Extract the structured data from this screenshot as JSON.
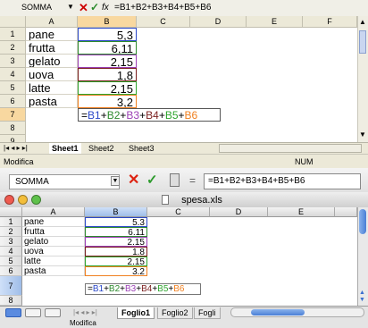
{
  "colors": {
    "b1": "#2b48c8",
    "b2": "#2e8b2e",
    "b3": "#9b3fb5",
    "b4": "#7a1f1f",
    "b5": "#2ea52e",
    "b6": "#f08020"
  },
  "win": {
    "name_box": "SOMMA",
    "formula": "=B1+B2+B3+B4+B5+B6",
    "fx_label": "fx",
    "columns": [
      "A",
      "B",
      "C",
      "D",
      "E",
      "F"
    ],
    "rows": [
      "1",
      "2",
      "3",
      "4",
      "5",
      "6",
      "7",
      "8",
      "9"
    ],
    "items": [
      {
        "name": "pane",
        "value": "5,3"
      },
      {
        "name": "frutta",
        "value": "6,11"
      },
      {
        "name": "gelato",
        "value": "2,15"
      },
      {
        "name": "uova",
        "value": "1,8"
      },
      {
        "name": "latte",
        "value": "2,15"
      },
      {
        "name": "pasta",
        "value": "3,2"
      }
    ],
    "formula_parts": [
      "=",
      "B1",
      "+",
      "B2",
      "+",
      "B3",
      "+",
      "B4",
      "+",
      "B5",
      "+",
      "B6"
    ],
    "sheet_tabs": [
      "Sheet1",
      "Sheet2",
      "Sheet3"
    ],
    "status_left": "Modifica",
    "status_right": "NUM"
  },
  "mac": {
    "name_box": "SOMMA",
    "formula_eq": "=",
    "formula": "=B1+B2+B3+B4+B5+B6",
    "title": "spesa.xls",
    "columns": [
      "A",
      "B",
      "C",
      "D",
      "E"
    ],
    "rows": [
      "1",
      "2",
      "3",
      "4",
      "5",
      "6",
      "7",
      "8"
    ],
    "items": [
      {
        "name": "pane",
        "value": "5.3"
      },
      {
        "name": "frutta",
        "value": "6.11"
      },
      {
        "name": "gelato",
        "value": "2.15"
      },
      {
        "name": "uova",
        "value": "1.8"
      },
      {
        "name": "latte",
        "value": "2.15"
      },
      {
        "name": "pasta",
        "value": "3.2"
      }
    ],
    "formula_parts": [
      "=",
      "B1",
      "+",
      "B2",
      "+",
      "B3",
      "+",
      "B4",
      "+",
      "B5",
      "+",
      "B6"
    ],
    "sheet_tabs": [
      "Foglio1",
      "Foglio2",
      "Fogli"
    ],
    "status": "Modifica"
  }
}
